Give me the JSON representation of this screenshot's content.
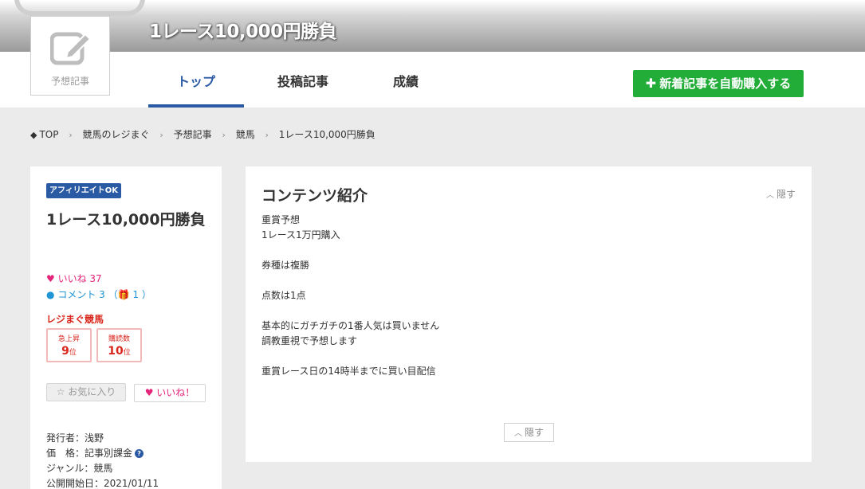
{
  "header": {
    "title": "1レース10,000円勝負"
  },
  "nav": {
    "thumb_label": "予想記事",
    "tabs": [
      {
        "label": "トップ",
        "active": true
      },
      {
        "label": "投稿記事",
        "active": false
      },
      {
        "label": "成績",
        "active": false
      }
    ],
    "auto_buy_plus": "✚",
    "auto_buy_label": "新着記事を自動購入する"
  },
  "breadcrumb": {
    "items": [
      "TOP",
      "競馬のレジまぐ",
      "予想記事",
      "競馬",
      "1レース10,000円勝負"
    ],
    "separator": "›"
  },
  "sidebar": {
    "badge": "アフィリエイトOK",
    "title": "1レース10,000円勝負",
    "likes_text": "いいね 37",
    "comments_text": "コメント 3 （",
    "gift_count": "1",
    "comments_close": "）",
    "rank_section_label": "レジまぐ競馬",
    "ranks": [
      {
        "label": "急上昇",
        "value": "9",
        "unit": "位"
      },
      {
        "label": "購読数",
        "value": "10",
        "unit": "位"
      }
    ],
    "favorite_button": "お気に入り",
    "like_button": "いいね！",
    "publisher": "発行者：浅野",
    "price": "価　格：記事別課金",
    "genre": "ジャンル：競馬",
    "start_date": "公開開始日：2021/01/11"
  },
  "content": {
    "title": "コンテンツ紹介",
    "hide_label": "隠す",
    "lines": [
      "重賞予想",
      "1レース1万円購入",
      "",
      "券種は複勝",
      "",
      "点数は1点",
      "",
      "基本的にガチガチの1番人気は買いません",
      "調教重視で予想します",
      "",
      "重賞レース日の14時半までに買い目配信"
    ]
  },
  "colors": {
    "accent_blue": "#2b5aa4",
    "green_button": "#22ad38",
    "like_pink": "#e4237a",
    "comment_blue": "#2096d6",
    "rank_red": "#d9261c"
  }
}
